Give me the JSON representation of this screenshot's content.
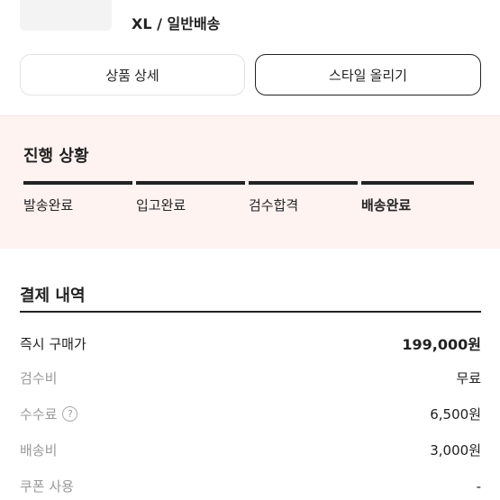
{
  "product": {
    "option": "XL / 일반배송"
  },
  "actions": {
    "detail_label": "상품 상세",
    "style_label": "스타일 올리기"
  },
  "progress": {
    "title": "진행 상황",
    "steps": [
      {
        "label": "발송완료"
      },
      {
        "label": "입고완료"
      },
      {
        "label": "검수합격"
      },
      {
        "label": "배송완료"
      }
    ],
    "current_step": "배송완료"
  },
  "payment": {
    "title": "결제 내역",
    "rows": [
      {
        "label": "즉시 구매가",
        "value": "199,000원"
      },
      {
        "label": "검수비",
        "value": "무료"
      },
      {
        "label": "수수료",
        "value": "6,500원",
        "help": "?"
      },
      {
        "label": "배송비",
        "value": "3,000원"
      },
      {
        "label": "쿠폰 사용",
        "value": "-"
      }
    ]
  }
}
